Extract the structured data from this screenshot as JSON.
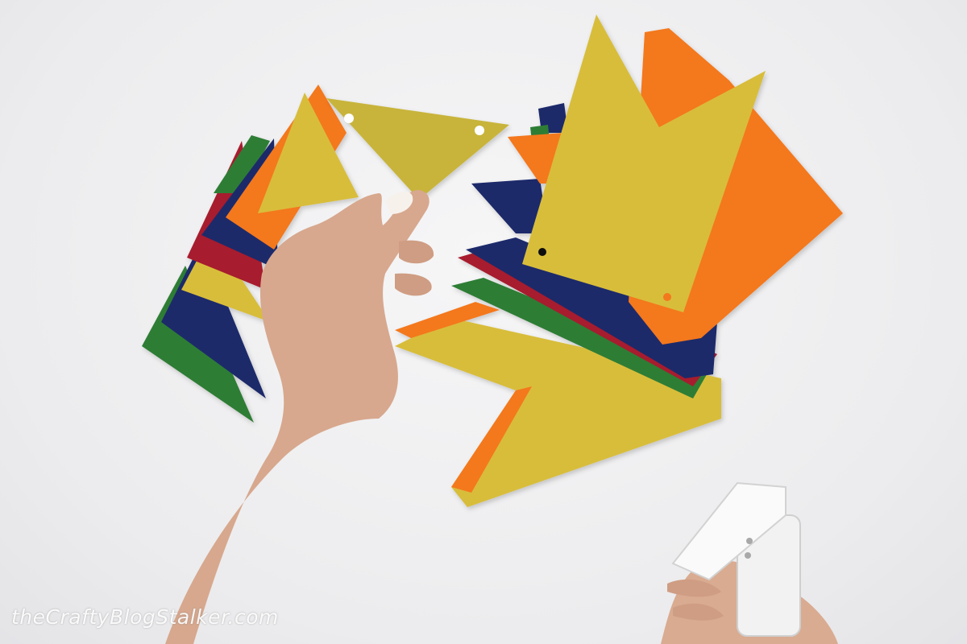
{
  "photo": {
    "watermark": "theCraftyBlogStalker.com"
  },
  "colors": {
    "background": "#efeff1",
    "yellow": "#d8bd3a",
    "olive_yellow": "#c8b43a",
    "orange": "#f4781f",
    "navy": "#1f2a6b",
    "red": "#a71d2d",
    "green": "#2f7d36",
    "skin": "#d7a88e",
    "punch_tool": "#f2f2f2"
  },
  "icons": [
    "hand-icon",
    "hole-punch-icon"
  ]
}
